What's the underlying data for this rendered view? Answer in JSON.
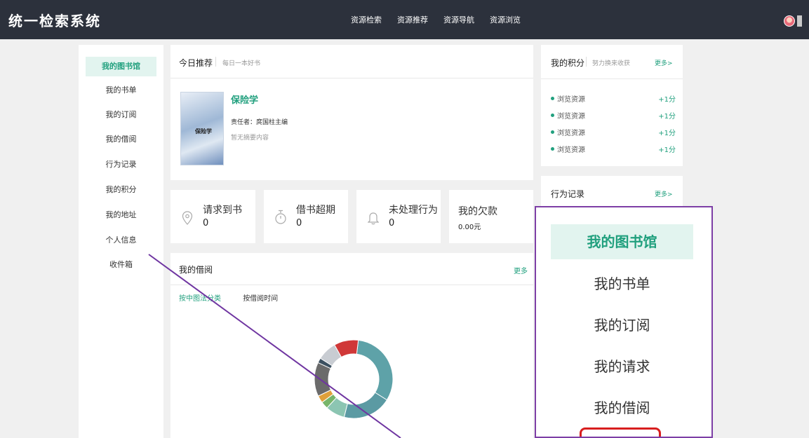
{
  "header": {
    "brand": "统一检索系统",
    "nav": [
      "资源检索",
      "资源推荐",
      "资源导航",
      "资源浏览"
    ]
  },
  "sidebar": {
    "items": [
      {
        "label": "我的图书馆",
        "active": true
      },
      {
        "label": "我的书单"
      },
      {
        "label": "我的订阅"
      },
      {
        "label": "我的借阅"
      },
      {
        "label": "行为记录"
      },
      {
        "label": "我的积分"
      },
      {
        "label": "我的地址"
      },
      {
        "label": "个人信息"
      },
      {
        "label": "收件箱"
      }
    ]
  },
  "recommend": {
    "title": "今日推荐",
    "subtitle": "每日一本好书",
    "book_title": "保险学",
    "cover_text": "保险学",
    "author": "责任者：庹国柱主编",
    "summary": "暂无摘要内容"
  },
  "stats": [
    {
      "label": "请求到书",
      "value": "0",
      "icon": "location-icon"
    },
    {
      "label": "借书超期",
      "value": "0",
      "icon": "timer-icon"
    },
    {
      "label": "未处理行为",
      "value": "0",
      "icon": "bell-icon"
    },
    {
      "label": "我的欠款",
      "value": "0.00元"
    }
  ],
  "borrow": {
    "title": "我的借阅",
    "more": "更多",
    "tab_active": "按中图法分类",
    "tab_other": "按借阅时间",
    "donut": [
      {
        "value": 32,
        "color": "#5ea2a8"
      },
      {
        "value": 20,
        "color": "#5b9aa3"
      },
      {
        "value": 8,
        "color": "#8cc5b2"
      },
      {
        "value": 3,
        "color": "#77b56a"
      },
      {
        "value": 3,
        "color": "#e0a03a"
      },
      {
        "value": 14,
        "color": "#6b6b6b"
      },
      {
        "value": 2,
        "color": "#3c5060"
      },
      {
        "value": 8,
        "color": "#c8ccd2"
      },
      {
        "value": 10,
        "color": "#d03838"
      }
    ]
  },
  "points": {
    "title": "我的积分",
    "subtitle": "努力换来收获",
    "more": "更多>",
    "rows": [
      {
        "name": "浏览资源",
        "pts": "+1分"
      },
      {
        "name": "浏览资源",
        "pts": "+1分"
      },
      {
        "name": "浏览资源",
        "pts": "+1分"
      },
      {
        "name": "浏览资源",
        "pts": "+1分"
      }
    ]
  },
  "behavior": {
    "title": "行为记录",
    "more": "更多>"
  },
  "zoom": {
    "items": [
      "我的图书馆",
      "我的书单",
      "我的订阅",
      "我的请求",
      "我的借阅"
    ]
  }
}
